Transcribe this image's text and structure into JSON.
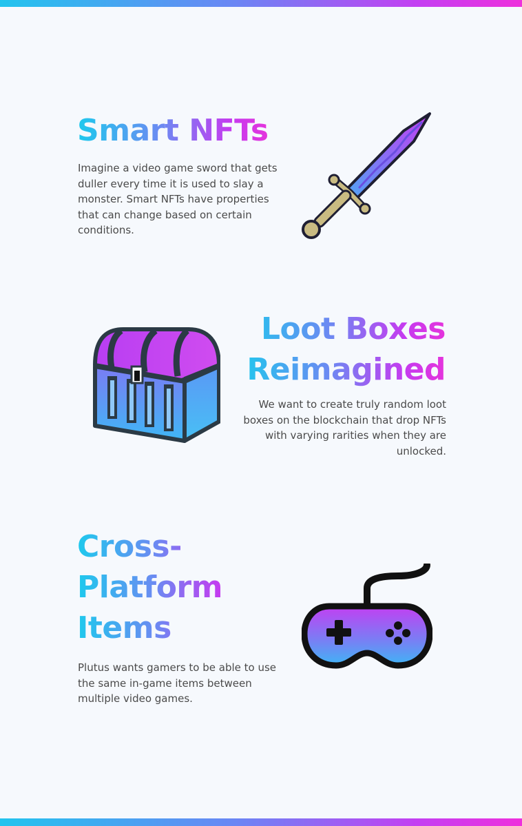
{
  "sections": [
    {
      "title": "Smart NFTs",
      "description": "Imagine a video game sword that gets duller every time it is used to slay a monster. Smart NFTs have properties that can change based on certain conditions.",
      "icon": "sword-icon"
    },
    {
      "title": "Loot Boxes Reimagined",
      "description": "We want to create truly random loot boxes on the blockchain that drop NFTs with varying rarities when they are unlocked.",
      "icon": "treasure-chest-icon"
    },
    {
      "title": "Cross-Platform Items",
      "description": "Plutus wants gamers to be able to use the same in-game items between multiple video games.",
      "icon": "gamepad-icon"
    }
  ],
  "colors": {
    "gradient_cyan": "#1ec9ed",
    "gradient_blue": "#6e88f2",
    "gradient_purple": "#c53bf0",
    "gradient_pink": "#e534dc",
    "background": "#f6f9fd",
    "text": "#4a4a4a"
  }
}
